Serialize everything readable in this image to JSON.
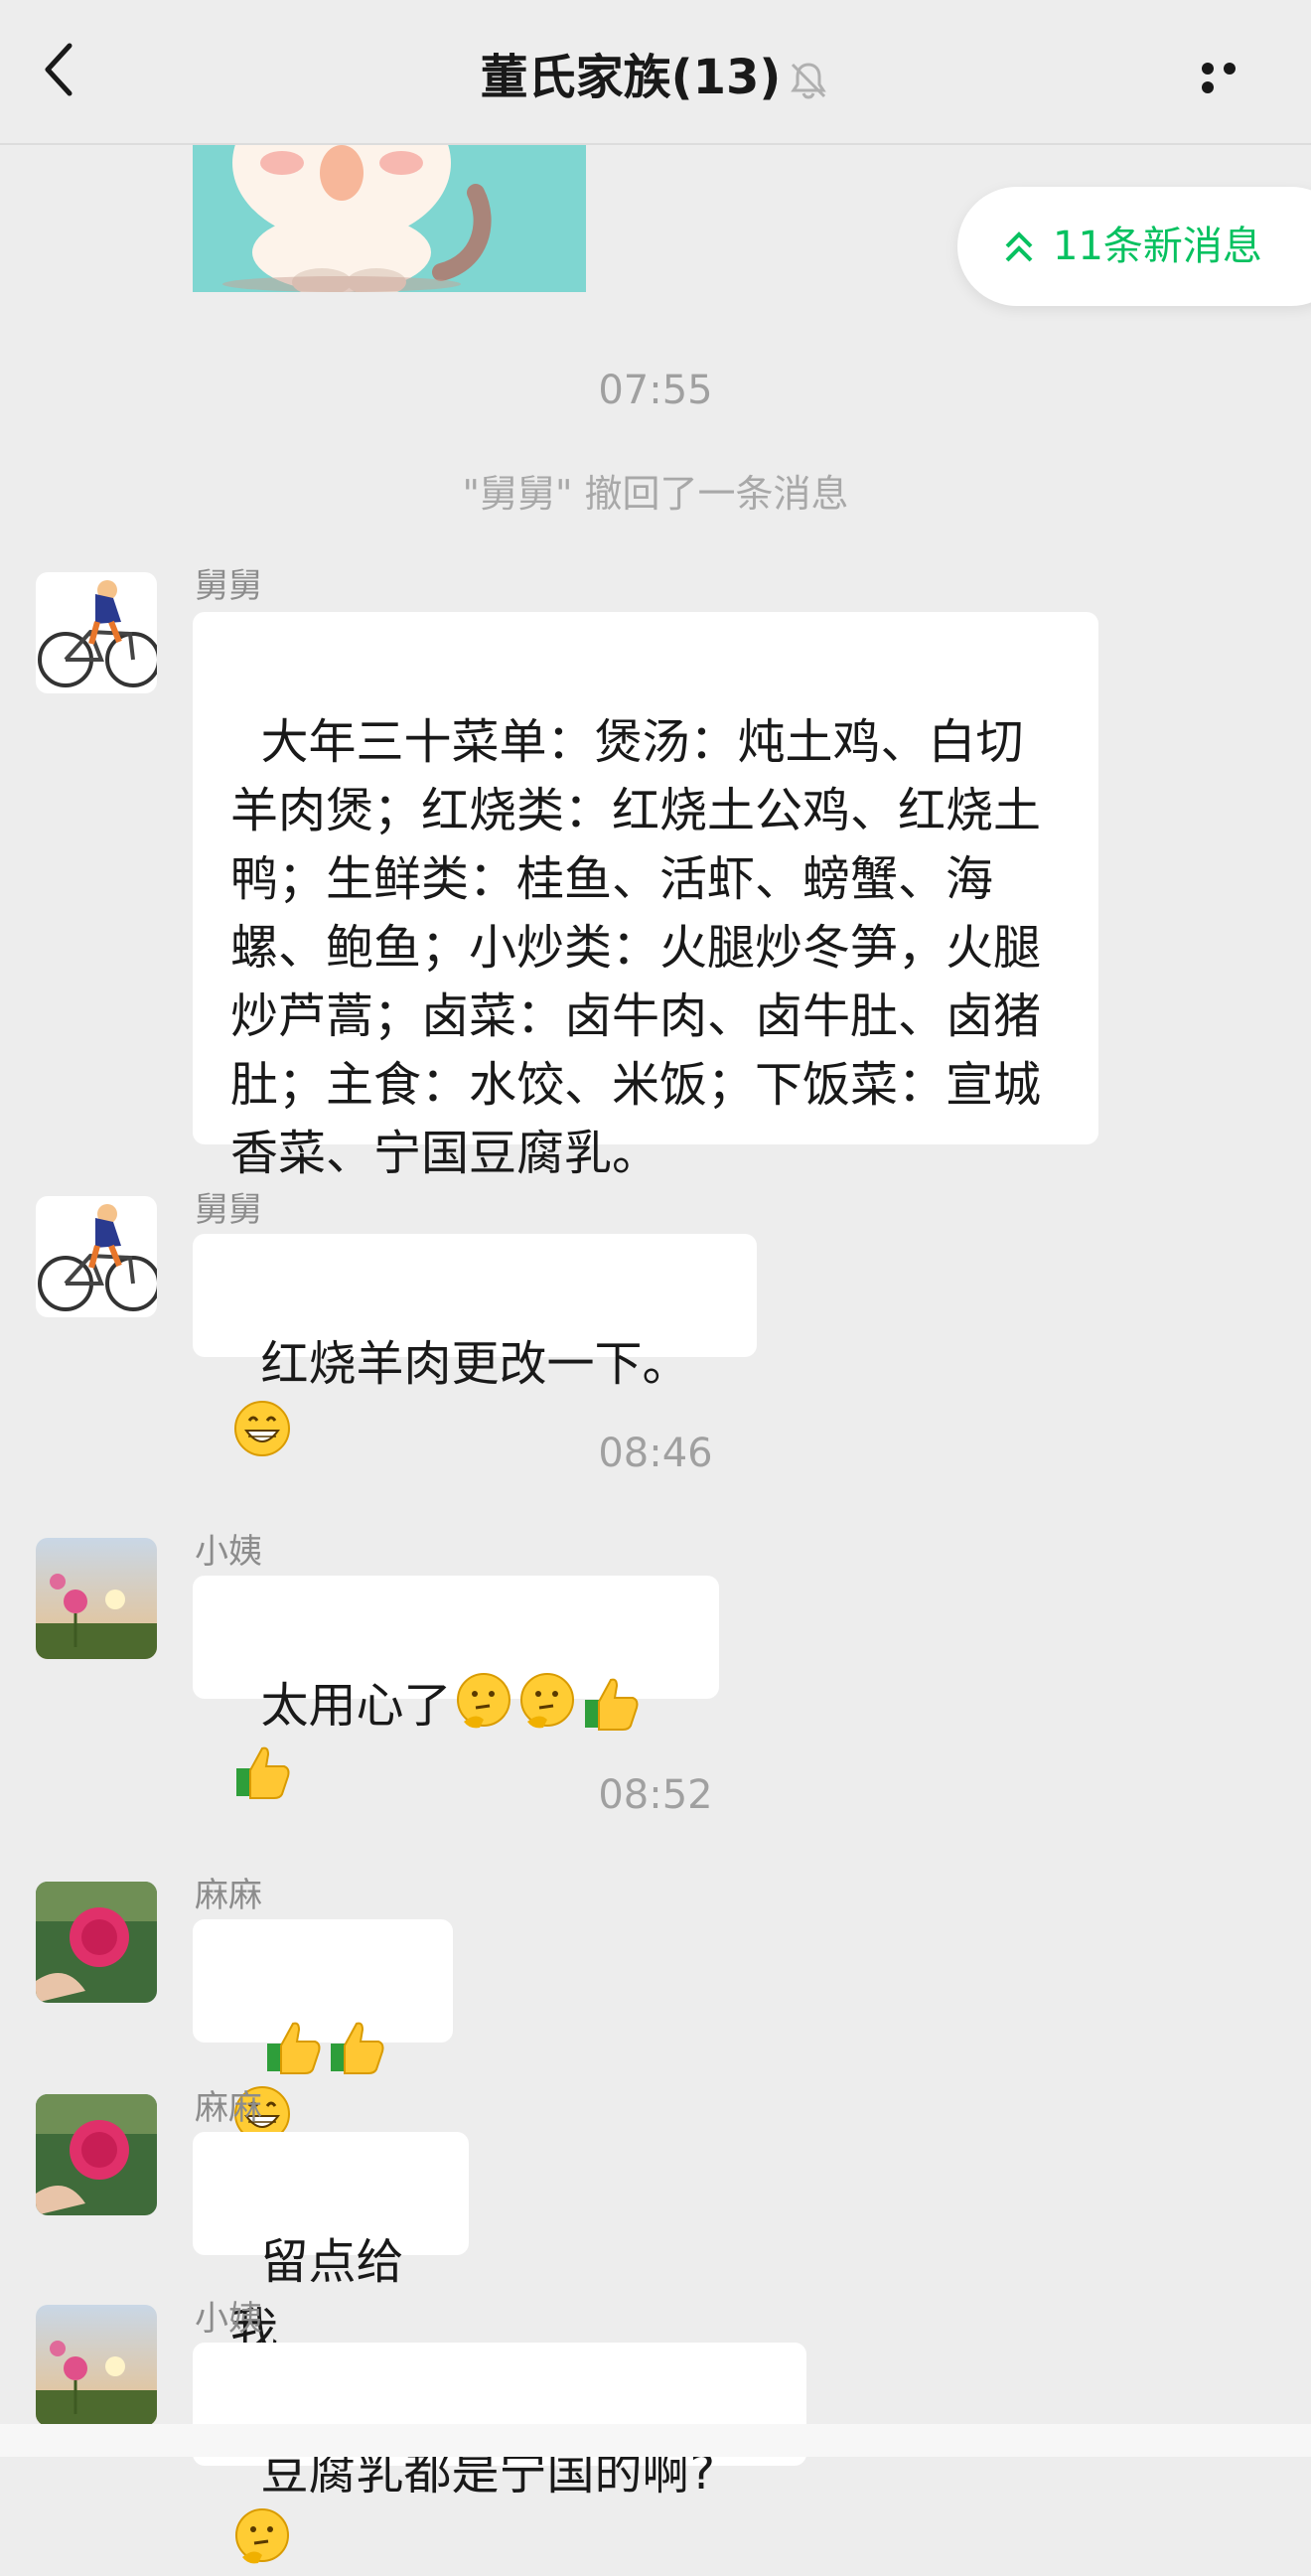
{
  "header": {
    "title": "董氏家族(13)",
    "back_icon": "chevron-left-icon",
    "mute_icon": "bell-muted-icon",
    "more_icon": "more-dots-icon"
  },
  "new_messages": {
    "label": "11条新消息",
    "icon": "double-chevron-up-icon",
    "color": "#07c160"
  },
  "timeline": {
    "t1": "07:55",
    "recall": "\"舅舅\" 撤回了一条消息",
    "t2": "08:46",
    "t3": "08:52"
  },
  "messages": [
    {
      "sender": "舅舅",
      "avatar": "cyclist-avatar",
      "text": "大年三十菜单：煲汤：炖土鸡、白切羊肉煲；红烧类：红烧土公鸡、红烧土鸭；生鲜类：桂鱼、活虾、螃蟹、海螺、鲍鱼；小炒类：火腿炒冬笋，火腿炒芦蒿；卤菜：卤牛肉、卤牛肚、卤猪肚；主食：水饺、米饭；下饭菜：宣城香菜、宁国豆腐乳。"
    },
    {
      "sender": "舅舅",
      "avatar": "cyclist-avatar",
      "text": "红烧羊肉更改一下。",
      "emojis": [
        "grin-emoji"
      ]
    },
    {
      "sender": "小姨",
      "avatar": "flower-sunset-avatar",
      "text": "太用心了",
      "emojis": [
        "thinking-emoji",
        "thinking-emoji",
        "thumbs-up-emoji",
        "thumbs-up-emoji"
      ]
    },
    {
      "sender": "麻麻",
      "avatar": "rose-avatar",
      "text": "",
      "emojis": [
        "thumbs-up-emoji",
        "thumbs-up-emoji",
        "grin-emoji"
      ]
    },
    {
      "sender": "麻麻",
      "avatar": "rose-avatar",
      "text": "留点给我"
    },
    {
      "sender": "小姨",
      "avatar": "flower-sunset-avatar",
      "text": "豆腐乳都是宁国的啊?",
      "emojis": [
        "thinking-emoji"
      ]
    }
  ],
  "colors": {
    "background": "#ededed",
    "bubble": "#ffffff",
    "accent": "#07c160"
  }
}
